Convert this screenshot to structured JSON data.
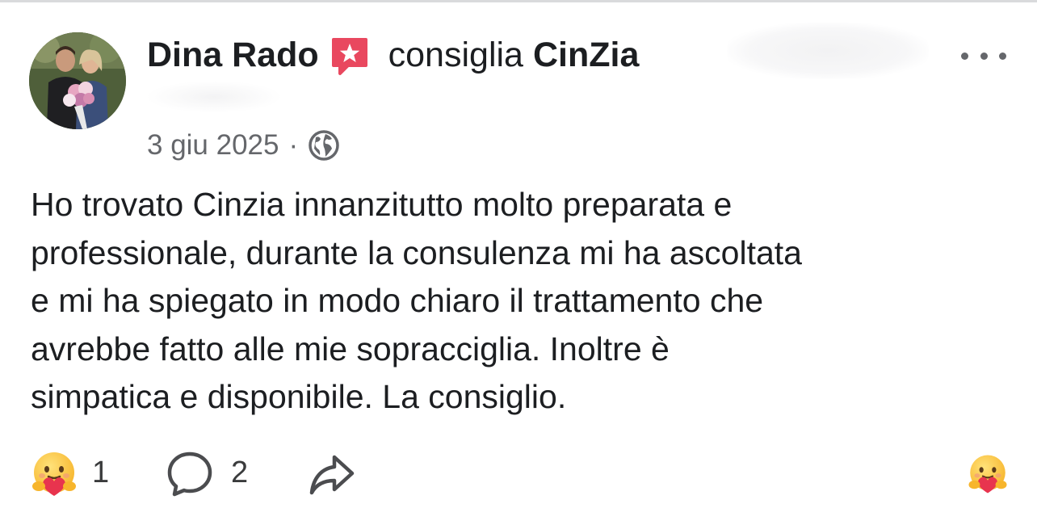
{
  "post": {
    "author": "Dina Rado",
    "action": "consiglia",
    "page": "CinZia",
    "date": "3 giu 2025",
    "separator": "·",
    "visibility_icon": "globe-icon",
    "body": "Ho trovato Cinzia innanzitutto molto preparata e\nprofessionale, durante la consulenza mi ha ascoltata\ne mi ha spiegato in modo chiaro il trattamento che\navrebbe fatto alle mie sopracciglia. Inoltre è\nsimpatica e disponibile. La consiglio."
  },
  "footer": {
    "reaction_icon": "care-reaction-icon",
    "reaction_count": "1",
    "comment_icon": "comment-icon",
    "comment_count": "2",
    "share_icon": "share-icon"
  },
  "colors": {
    "text": "#1c1e21",
    "secondary": "#65676b",
    "recommend_badge": "#e9485f"
  }
}
